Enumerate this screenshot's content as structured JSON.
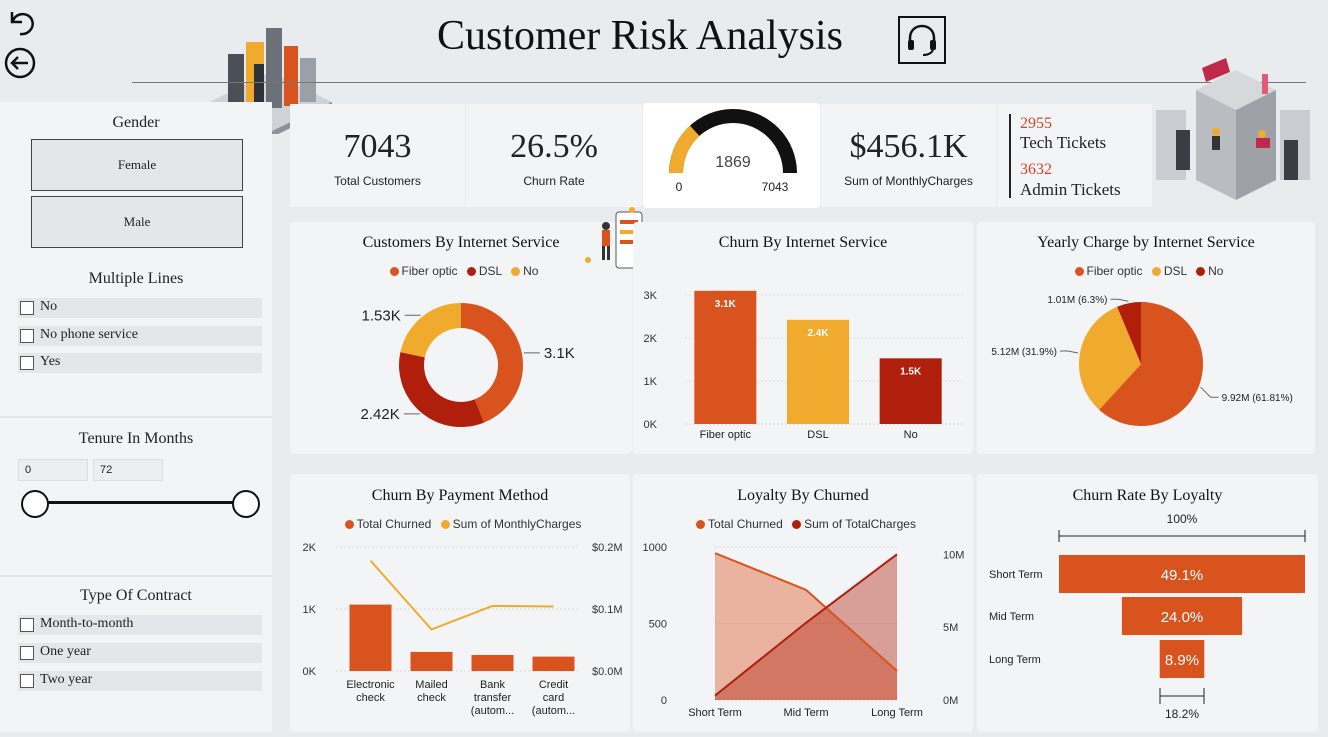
{
  "header": {
    "title": "Customer Risk Analysis",
    "back_icon": "undo-icon",
    "nav_icon": "arrow-left-circle-icon",
    "support_icon": "headset-icon"
  },
  "filters": {
    "gender": {
      "title": "Gender",
      "options": [
        "Female",
        "Male"
      ]
    },
    "multiple_lines": {
      "title": "Multiple Lines",
      "options": [
        "No",
        "No phone service",
        "Yes"
      ]
    },
    "tenure": {
      "title": "Tenure In Months",
      "min": "0",
      "max": "72"
    },
    "contract": {
      "title": "Type Of Contract",
      "options": [
        "Month-to-month",
        "One year",
        "Two year"
      ]
    }
  },
  "kpis": {
    "total_customers": {
      "value": "7043",
      "label": "Total Customers"
    },
    "churn_rate": {
      "value": "26.5%",
      "label": "Churn Rate"
    },
    "gauge": {
      "value": "1869",
      "min": "0",
      "max": "7043",
      "fraction": 0.2654
    },
    "monthly_charges": {
      "value": "$456.1K",
      "label": "Sum of MonthlyCharges"
    },
    "tech_tickets": {
      "value": "2955",
      "label": "Tech Tickets"
    },
    "admin_tickets": {
      "value": "3632",
      "label": "Admin Tickets"
    }
  },
  "colors": {
    "orange": "#d9531e",
    "yellow": "#f0ab2e",
    "darkred": "#b01e0c",
    "accent_text": "#d2452a"
  },
  "chart_data": [
    {
      "id": "customers_by_internet",
      "type": "pie",
      "donut": true,
      "title": "Customers By Internet Service",
      "legend": [
        "Fiber optic",
        "DSL",
        "No"
      ],
      "values": [
        3096,
        2421,
        1526
      ],
      "labels": [
        "3.1K",
        "2.42K",
        "1.53K"
      ]
    },
    {
      "id": "churn_by_internet",
      "type": "bar",
      "title": "Churn By Internet Service",
      "categories": [
        "Fiber optic",
        "DSL",
        "No"
      ],
      "values": [
        3096,
        2421,
        1526
      ],
      "labels": [
        "3.1K",
        "2.4K",
        "1.5K"
      ],
      "yticks": [
        "0K",
        "1K",
        "2K",
        "3K"
      ],
      "ylim": [
        0,
        3300
      ]
    },
    {
      "id": "yearly_charge_by_internet",
      "type": "pie",
      "title": "Yearly Charge by Internet Service",
      "legend": [
        "Fiber optic",
        "DSL",
        "No"
      ],
      "values": [
        9.92,
        5.12,
        1.01
      ],
      "labels": [
        "9.92M (61.81%)",
        "5.12M (31.9%)",
        "1.01M (6.3%)"
      ]
    },
    {
      "id": "churn_by_payment",
      "type": "bar",
      "title": "Churn By Payment Method",
      "legend": [
        "Total Churned",
        "Sum of MonthlyCharges"
      ],
      "categories": [
        [
          "Electronic",
          "check"
        ],
        [
          "Mailed",
          "check"
        ],
        [
          "Bank",
          "transfer",
          "(autom..."
        ],
        [
          "Credit",
          "card",
          "(autom..."
        ]
      ],
      "series": [
        {
          "name": "Total Churned",
          "values": [
            1071,
            308,
            258,
            232
          ],
          "ylim": [
            0,
            2000
          ]
        },
        {
          "name": "Sum of MonthlyCharges",
          "values": [
            0.178,
            0.067,
            0.105,
            0.104
          ],
          "ylim": [
            0,
            0.2
          ]
        }
      ],
      "yticks_left": [
        "0K",
        "1K",
        "2K"
      ],
      "yticks_right": [
        "$0.0M",
        "$0.1M",
        "$0.2M"
      ]
    },
    {
      "id": "loyalty_by_churned",
      "type": "area",
      "title": "Loyalty By Churned",
      "legend": [
        "Total Churned",
        "Sum of TotalCharges"
      ],
      "categories": [
        "Short Term",
        "Mid Term",
        "Long Term"
      ],
      "series": [
        {
          "name": "Total Churned",
          "values": [
            960,
            720,
            190
          ],
          "ylim": [
            0,
            1000
          ]
        },
        {
          "name": "Sum of TotalCharges",
          "values": [
            0.3,
            5.3,
            10.0
          ],
          "ylim": [
            0,
            10.5
          ]
        }
      ],
      "yticks_left": [
        "0",
        "500",
        "1000"
      ],
      "yticks_right": [
        "0M",
        "5M",
        "10M"
      ]
    },
    {
      "id": "churn_rate_by_loyalty",
      "type": "bar",
      "orientation": "funnel",
      "title": "Churn Rate By Loyalty",
      "categories": [
        "Short Term",
        "Mid Term",
        "Long Term"
      ],
      "values": [
        49.1,
        24.0,
        8.9
      ],
      "labels": [
        "49.1%",
        "24.0%",
        "8.9%"
      ],
      "top_label": "100%",
      "bottom_label": "18.2%"
    }
  ]
}
